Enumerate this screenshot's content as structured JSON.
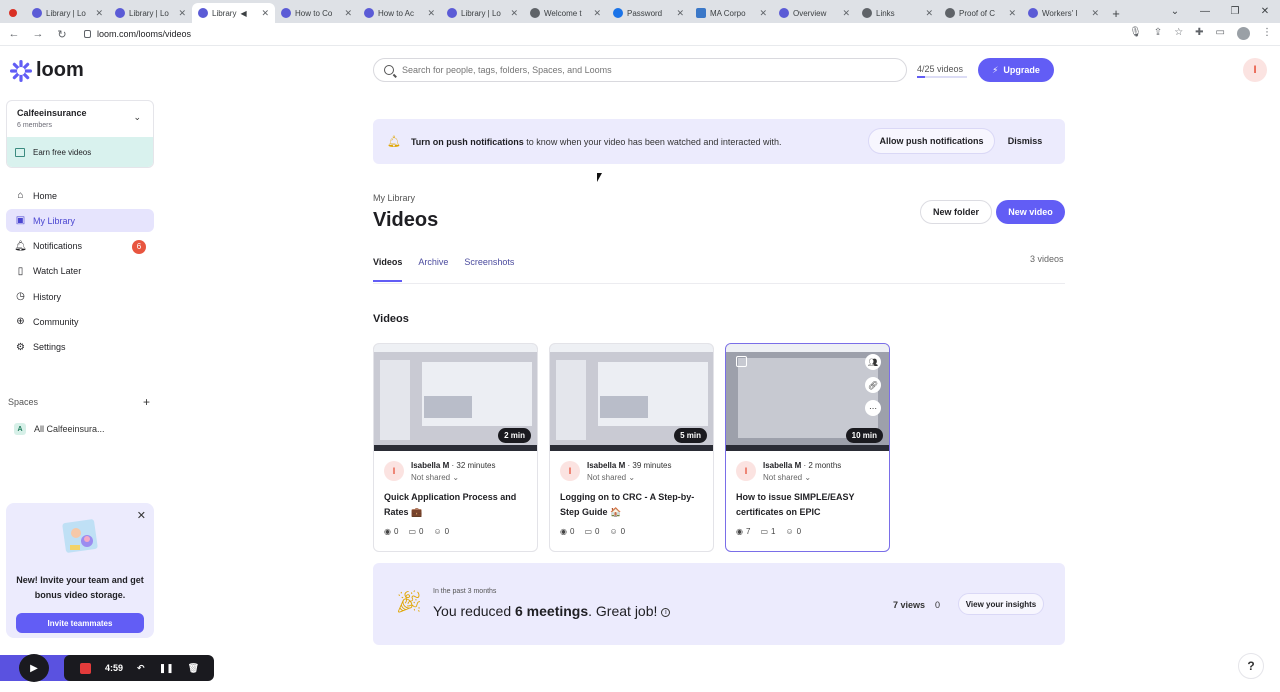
{
  "browser": {
    "tabs": [
      {
        "label": "Library | Lo"
      },
      {
        "label": "Library | Lo"
      },
      {
        "label": "Library"
      },
      {
        "label": "How to Co"
      },
      {
        "label": "How to Ac"
      },
      {
        "label": "Library | Lo"
      },
      {
        "label": "Welcome t"
      },
      {
        "label": "Password"
      },
      {
        "label": "MA Corpo"
      },
      {
        "label": "Overview"
      },
      {
        "label": "Links"
      },
      {
        "label": "Proof of C"
      },
      {
        "label": "Workers' I"
      }
    ],
    "new_tab": "+",
    "url": "loom.com/looms/videos"
  },
  "sidebar": {
    "logo": "loom",
    "workspace": {
      "name": "Calfeeinsurance",
      "members": "6 members",
      "earn": "Earn free videos"
    },
    "nav": [
      {
        "label": "Home",
        "icon": "home-icon",
        "glyph": "⌂"
      },
      {
        "label": "My Library",
        "icon": "library-icon",
        "glyph": "▣"
      },
      {
        "label": "Notifications",
        "icon": "bell-icon",
        "glyph": "♫"
      },
      {
        "label": "Watch Later",
        "icon": "bookmark-icon",
        "glyph": "▯"
      },
      {
        "label": "History",
        "icon": "clock-icon",
        "glyph": "◷"
      },
      {
        "label": "Community",
        "icon": "globe-icon",
        "glyph": "⊕"
      },
      {
        "label": "Settings",
        "icon": "gear-icon",
        "glyph": "⚙"
      }
    ],
    "notifications_badge": "6",
    "spaces_heading": "Spaces",
    "space_item": {
      "initial": "A",
      "label": "All Calfeeinsura..."
    },
    "promo": {
      "text": "New! Invite your team and get bonus video storage.",
      "button": "Invite teammates"
    }
  },
  "recorder": {
    "time": "4:59"
  },
  "header": {
    "search_placeholder": "Search for people, tags, folders, Spaces, and Looms",
    "video_count": "4/25 videos",
    "upgrade": "Upgrade",
    "user_initial": "I"
  },
  "notification": {
    "bold": "Turn on push notifications",
    "rest": " to know when your video has been watched and interacted with.",
    "allow": "Allow push notifications",
    "dismiss": "Dismiss"
  },
  "library": {
    "label": "My Library",
    "title": "Videos",
    "new_folder": "New folder",
    "new_video": "New video",
    "tabs": [
      "Videos",
      "Archive",
      "Screenshots"
    ],
    "total": "3 videos",
    "section": "Videos"
  },
  "videos": [
    {
      "author": "Isabella M",
      "age": "· 32 minutes",
      "share": "Not shared",
      "title": "Quick Application Process and Rates 💼",
      "duration": "2 min",
      "views": "0",
      "comments": "0",
      "reactions": "0"
    },
    {
      "author": "Isabella M",
      "age": "· 39 minutes",
      "share": "Not shared",
      "title": "Logging on to CRC - A Step-by-Step Guide 🏠",
      "duration": "5 min",
      "views": "0",
      "comments": "0",
      "reactions": "0"
    },
    {
      "author": "Isabella M",
      "age": "· 2 months",
      "share": "Not shared",
      "title": "How to issue SIMPLE/EASY certificates on EPIC",
      "duration": "10 min",
      "views": "7",
      "comments": "1",
      "reactions": "0"
    }
  ],
  "insights": {
    "small": "In the past 3 months",
    "pre": "You reduced ",
    "bold": "6 meetings",
    "post": ". Great job!",
    "views": "7 views",
    "zero": "0",
    "button": "View your insights"
  },
  "help": "?"
}
